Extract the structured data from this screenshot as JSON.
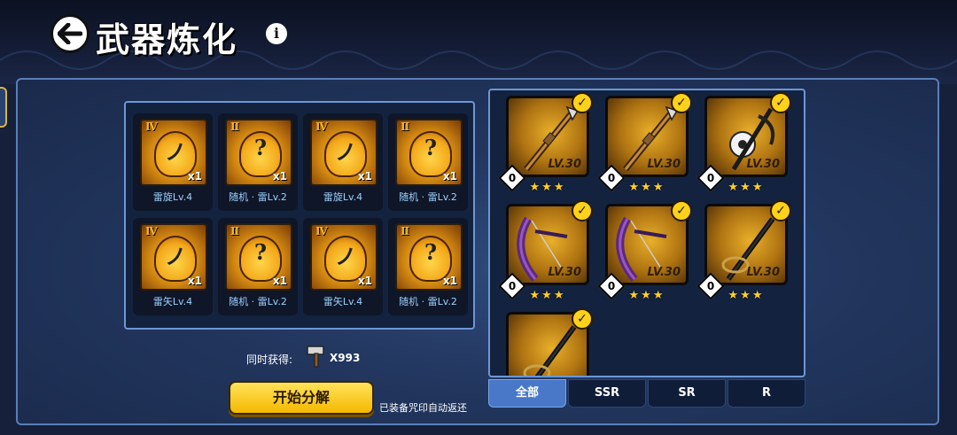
{
  "header": {
    "title": "武器炼化",
    "info": "i"
  },
  "materials": [
    {
      "rank": "Ⅳ",
      "glyph": "ノ",
      "qty": "x1",
      "name": "雷旋Lv.4"
    },
    {
      "rank": "Ⅱ",
      "glyph": "?",
      "qty": "x1",
      "name": "随机 · 雷Lv.2"
    },
    {
      "rank": "Ⅳ",
      "glyph": "ノ",
      "qty": "x1",
      "name": "雷旋Lv.4"
    },
    {
      "rank": "Ⅱ",
      "glyph": "?",
      "qty": "x1",
      "name": "随机 · 雷Lv.2"
    },
    {
      "rank": "Ⅳ",
      "glyph": "ノ",
      "qty": "x1",
      "name": "雷矢Lv.4"
    },
    {
      "rank": "Ⅱ",
      "glyph": "?",
      "qty": "x1",
      "name": "随机 · 雷Lv.2"
    },
    {
      "rank": "Ⅳ",
      "glyph": "ノ",
      "qty": "x1",
      "name": "雷矢Lv.4"
    },
    {
      "rank": "Ⅱ",
      "glyph": "?",
      "qty": "x1",
      "name": "随机 · 雷Lv.2"
    }
  ],
  "reward": {
    "label": "同时获得:",
    "icon": "hammer-icon",
    "count": "X993"
  },
  "actions": {
    "start_label": "开始分解",
    "auto_return_note": "已装备咒印自动返还"
  },
  "weapons": [
    {
      "kind": "spear",
      "level": "LV.30",
      "badge": "0",
      "stars": "★★★",
      "checked": true
    },
    {
      "kind": "spear",
      "level": "LV.30",
      "badge": "0",
      "stars": "★★★",
      "checked": true
    },
    {
      "kind": "scythe-gold",
      "level": "LV.30",
      "badge": "0",
      "stars": "★★★",
      "checked": true
    },
    {
      "kind": "bow",
      "level": "LV.30",
      "badge": "0",
      "stars": "★★★",
      "checked": true
    },
    {
      "kind": "bow",
      "level": "LV.30",
      "badge": "0",
      "stars": "★★★",
      "checked": true
    },
    {
      "kind": "sword",
      "level": "LV.30",
      "badge": "0",
      "stars": "★★★",
      "checked": true
    },
    {
      "kind": "sword",
      "level": "",
      "badge": "",
      "stars": "",
      "checked": true
    }
  ],
  "tabs": [
    {
      "label": "全部",
      "active": true
    },
    {
      "label": "SSR",
      "active": false
    },
    {
      "label": "SR",
      "active": false
    },
    {
      "label": "R",
      "active": false
    }
  ],
  "colors": {
    "accent": "#ffd21a",
    "panel_border": "#6d97d6",
    "material_name": "#9ed1ff"
  }
}
